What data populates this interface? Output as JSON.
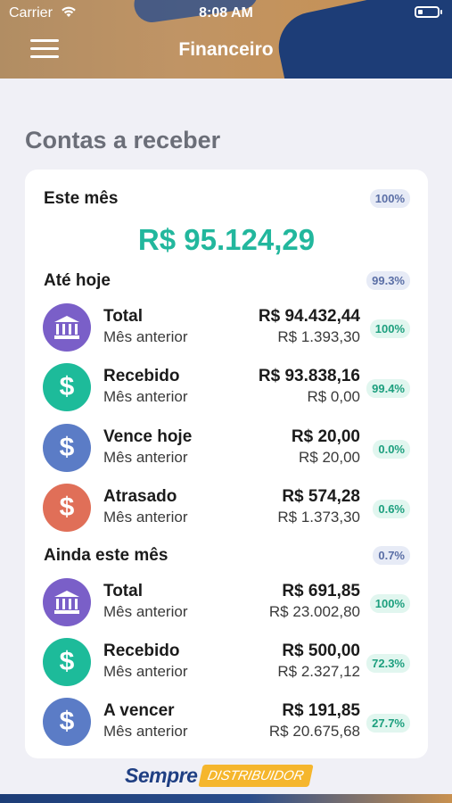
{
  "status_bar": {
    "carrier": "Carrier",
    "time": "8:08 AM"
  },
  "header": {
    "title": "Financeiro"
  },
  "page": {
    "section_title": "Contas a receber"
  },
  "this_month": {
    "label": "Este mês",
    "pct": "100%",
    "value": "R$ 95.124,29"
  },
  "until_today": {
    "label": "Até hoje",
    "pct": "99.3%",
    "items": [
      {
        "name": "Total",
        "sub": "Mês anterior",
        "value": "R$ 94.432,44",
        "prev": "R$ 1.393,30",
        "pct": "100%",
        "icon": "bank-icon"
      },
      {
        "name": "Recebido",
        "sub": "Mês anterior",
        "value": "R$ 93.838,16",
        "prev": "R$ 0,00",
        "pct": "99.4%",
        "icon": "dollar-icon"
      },
      {
        "name": "Vence hoje",
        "sub": "Mês anterior",
        "value": "R$ 20,00",
        "prev": "R$ 20,00",
        "pct": "0.0%",
        "icon": "dollar-icon"
      },
      {
        "name": "Atrasado",
        "sub": "Mês anterior",
        "value": "R$ 574,28",
        "prev": "R$ 1.373,30",
        "pct": "0.6%",
        "icon": "dollar-icon"
      }
    ]
  },
  "rest_of_month": {
    "label": "Ainda este mês",
    "pct": "0.7%",
    "items": [
      {
        "name": "Total",
        "sub": "Mês anterior",
        "value": "R$ 691,85",
        "prev": "R$ 23.002,80",
        "pct": "100%",
        "icon": "bank-icon"
      },
      {
        "name": "Recebido",
        "sub": "Mês anterior",
        "value": "R$ 500,00",
        "prev": "R$ 2.327,12",
        "pct": "72.3%",
        "icon": "dollar-icon"
      },
      {
        "name": "A vencer",
        "sub": "Mês anterior",
        "value": "R$ 191,85",
        "prev": "R$ 20.675,68",
        "pct": "27.7%",
        "icon": "dollar-icon"
      }
    ]
  },
  "footer": {
    "brand_primary": "Sempre",
    "brand_secondary": "DISTRIBUIDOR"
  },
  "colors": {
    "accent_green": "#22b79d",
    "purple": "#7a5fc8",
    "teal": "#1dbb9a",
    "blue": "#5b7cc6",
    "red": "#e06f58",
    "navy": "#1d3d77",
    "gold": "#c9914f"
  }
}
